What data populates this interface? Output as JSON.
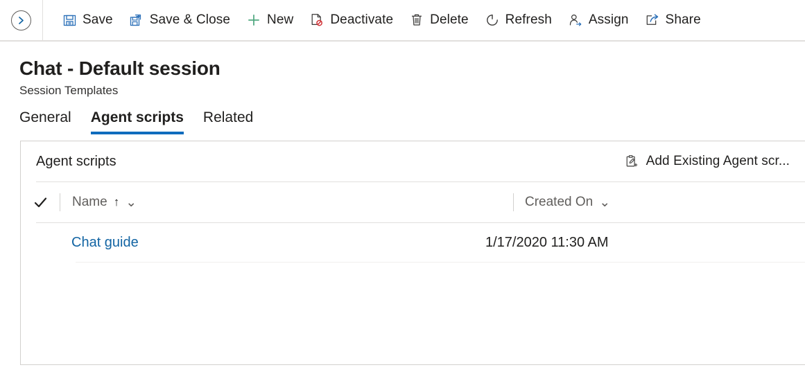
{
  "commandbar": {
    "nav_back_icon": "chevron-right-circle-icon",
    "buttons": [
      {
        "label": "Save",
        "icon": "save-floppy-icon"
      },
      {
        "label": "Save & Close",
        "icon": "save-and-close-icon"
      },
      {
        "label": "New",
        "icon": "plus-icon"
      },
      {
        "label": "Deactivate",
        "icon": "document-blocked-icon"
      },
      {
        "label": "Delete",
        "icon": "trash-icon"
      },
      {
        "label": "Refresh",
        "icon": "refresh-circular-arrow-icon"
      },
      {
        "label": "Assign",
        "icon": "person-assign-icon"
      },
      {
        "label": "Share",
        "icon": "share-arrow-icon"
      }
    ]
  },
  "header": {
    "title": "Chat - Default session",
    "subtitle": "Session Templates"
  },
  "tabs": [
    {
      "label": "General",
      "active": false
    },
    {
      "label": "Agent scripts",
      "active": true
    },
    {
      "label": "Related",
      "active": false
    }
  ],
  "panel": {
    "title": "Agent scripts",
    "action": {
      "label": "Add Existing Agent scr...",
      "icon": "clipboard-add-icon"
    },
    "columns": [
      {
        "key": "name",
        "label": "Name",
        "sort": "↑",
        "chevron": "⌄"
      },
      {
        "key": "createdon",
        "label": "Created On",
        "chevron": "⌄"
      }
    ],
    "select_all_icon": "checkmark-icon",
    "rows": [
      {
        "name": "Chat guide",
        "createdon": "1/17/2020 11:30 AM"
      }
    ]
  },
  "colors": {
    "accent": "#0f6cbd",
    "link": "#1264a3",
    "new_green": "#4ea77f",
    "delete_red": "#d13438",
    "border": "#d2d0ce",
    "text": "#201f1e",
    "muted": "#605e5c"
  }
}
